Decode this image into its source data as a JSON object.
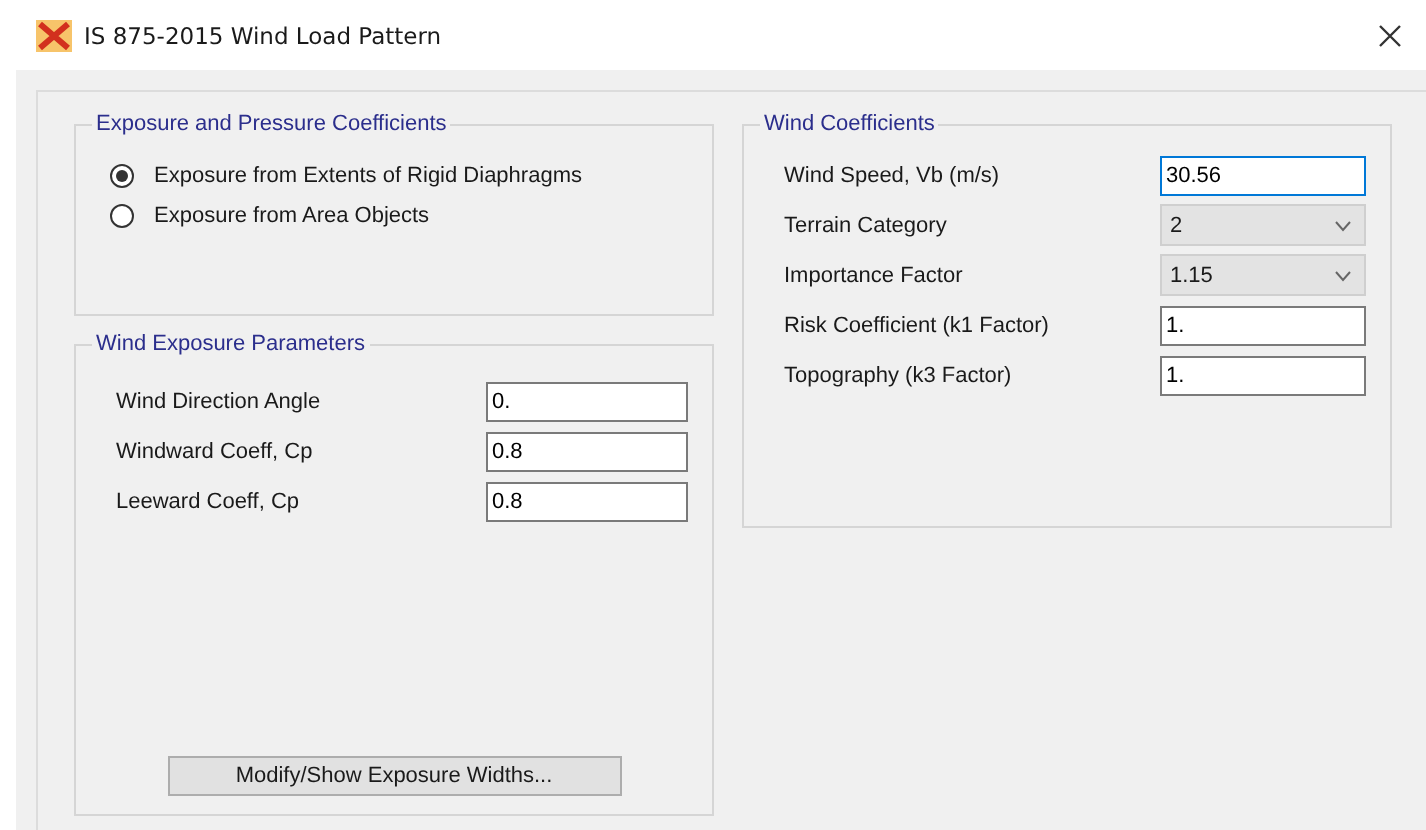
{
  "window": {
    "title": "IS 875-2015 Wind Load Pattern"
  },
  "exposure_group": {
    "title": "Exposure and Pressure Coefficients",
    "options": [
      {
        "label": "Exposure from Extents of Rigid Diaphragms",
        "selected": true
      },
      {
        "label": "Exposure from Area Objects",
        "selected": false
      }
    ]
  },
  "parameters_group": {
    "title": "Wind Exposure Parameters",
    "fields": [
      {
        "label": "Wind Direction Angle",
        "kind": "text",
        "value": "0.",
        "focused": false
      },
      {
        "label": "Windward Coeff, Cp",
        "kind": "text",
        "value": "0.8",
        "focused": false
      },
      {
        "label": "Leeward Coeff, Cp",
        "kind": "text",
        "value": "0.8",
        "focused": false
      }
    ],
    "button": "Modify/Show Exposure Widths..."
  },
  "coefficients_group": {
    "title": "Wind Coefficients",
    "fields": [
      {
        "label": "Wind Speed, Vb (m/s)",
        "kind": "text",
        "value": "30.56",
        "focused": true
      },
      {
        "label": "Terrain Category",
        "kind": "dropdown",
        "value": "2",
        "focused": false
      },
      {
        "label": "Importance Factor",
        "kind": "dropdown",
        "value": "1.15",
        "focused": false
      },
      {
        "label": "Risk Coefficient (k1 Factor)",
        "kind": "text",
        "value": "1.",
        "focused": false
      },
      {
        "label": "Topography (k3 Factor)",
        "kind": "text",
        "value": "1.",
        "focused": false
      }
    ]
  }
}
